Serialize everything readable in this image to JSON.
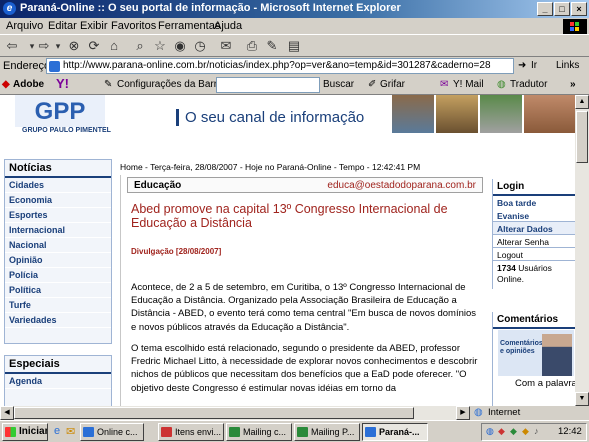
{
  "window": {
    "title": "Paraná-Online :: O seu portal de informação - Microsoft Internet Explorer",
    "min": "_",
    "max": "□",
    "close": "×"
  },
  "menu": [
    "Arquivo",
    "Editar",
    "Exibir",
    "Favoritos",
    "Ferramentas",
    "Ajuda"
  ],
  "address": {
    "label": "Endereço",
    "url": "http://www.parana-online.com.br/noticias/index.php?op=ver&ano=temp&id=301287&caderno=28",
    "go_label": "Ir",
    "links_label": "Links"
  },
  "linksbar": {
    "adobe": "Adobe",
    "yahoo": "Y!",
    "config": "Configurações da Barra",
    "buscar": "Buscar",
    "grifar": "Grifar",
    "mail": "Y! Mail",
    "tradutor": "Tradutor"
  },
  "banner": {
    "logo_text": "GPP",
    "group": "GRUPO PAULO PIMENTEL",
    "tagline": "O seu canal de informação"
  },
  "nav": {
    "noticias_header": "Notícias",
    "items": [
      "Cidades",
      "Economia",
      "Esportes",
      "Internacional",
      "Nacional",
      "Opinião",
      "Polícia",
      "Política",
      "Turfe",
      "Variedades"
    ],
    "especiais_header": "Especiais",
    "especiais_items": [
      "Agenda"
    ]
  },
  "homeline": "Home - Terça-feira, 28/08/2007 - Hoje no Paraná-Online - Tempo - 12:42:41 PM",
  "article": {
    "section": "Educação",
    "email": "educa@oestadodoparana.com.br",
    "headline": "Abed promove na capital 13º Congresso Internacional de Educação a Distância",
    "divulgacao": "Divulgação [28/08/2007]",
    "para1": "Acontece, de 2 a 5 de setembro, em Curitiba, o  13º Congresso Internacional de Educação a Distância. Organizado pela Associação Brasileira de Educação a Distância - ABED, o evento terá como tema central \"Em busca de novos domínios e novos públicos através da Educação a Distância\".",
    "para2": "O tema escolhido está relacionado, segundo o presidente da ABED, professor Fredric Michael Litto, à necessidade de explorar novos conhecimentos e descobrir nichos de públicos que necessitam dos benefícios que a EaD pode oferecer. \"O objetivo deste Congresso é estimular novas idéias em torno da"
  },
  "login": {
    "header": "Login",
    "boa_tarde": "Boa tarde",
    "user": "Evanise",
    "alterar_dados": "Alterar Dados",
    "alterar_senha": "Alterar Senha",
    "logout": "Logout",
    "online_count": "1734",
    "online_label": "Usuários Online."
  },
  "comentarios": {
    "header": "Comentários",
    "promo": "Comentários e opiniões",
    "palavra": "Com a palavra"
  },
  "status": {
    "zone": "Internet"
  },
  "taskbar": {
    "start": "Iniciar",
    "tasks": [
      "Online c...",
      "Itens envi...",
      "Mailing c...",
      "Mailing P...",
      "Paraná-..."
    ],
    "clock": "12:42"
  }
}
